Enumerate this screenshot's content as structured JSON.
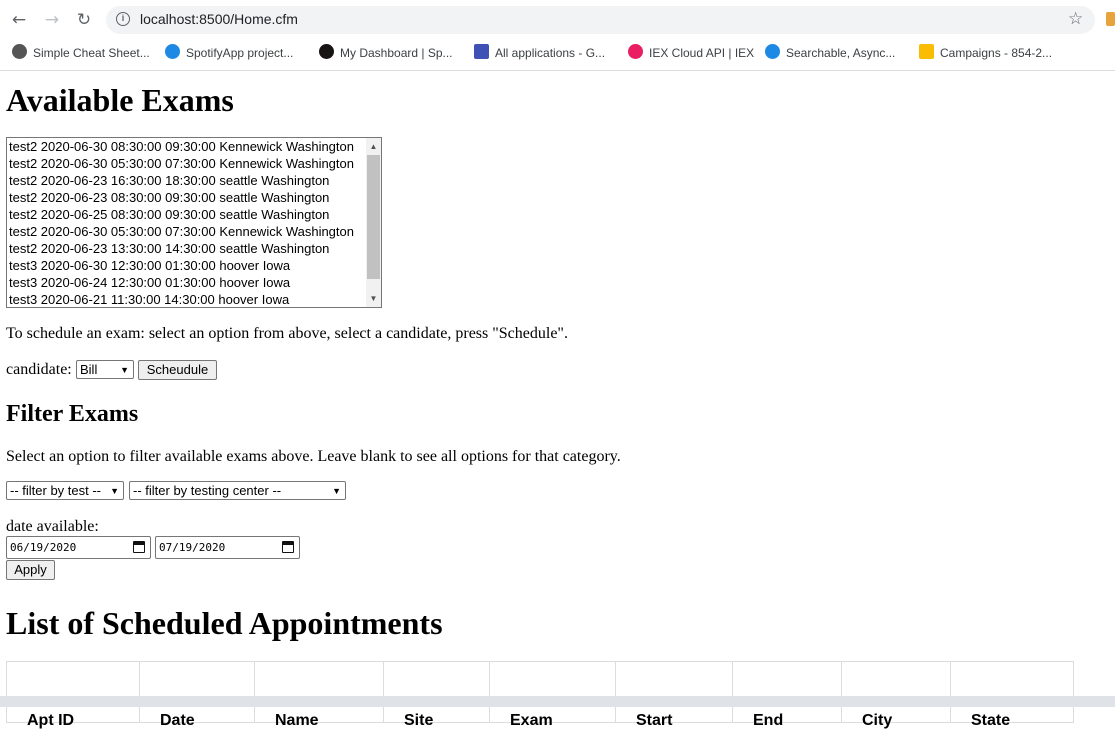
{
  "browser": {
    "url": "localhost:8500/Home.cfm",
    "bookmarks": [
      {
        "label": "Simple Cheat Sheet...",
        "color": "#555555"
      },
      {
        "label": "SpotifyApp project...",
        "color": "#1e88e5"
      },
      {
        "label": "My Dashboard | Sp...",
        "color": "#191414"
      },
      {
        "label": "All applications - G...",
        "color": "#3f51b5"
      },
      {
        "label": "IEX Cloud API | IEX",
        "color": "#e91e63"
      },
      {
        "label": "Searchable, Async...",
        "color": "#1e88e5"
      },
      {
        "label": "Campaigns - 854-2...",
        "color": "#fbbc04"
      }
    ]
  },
  "page": {
    "available_title": "Available Exams",
    "exams": [
      "test2 2020-06-30 08:30:00 09:30:00 Kennewick Washington",
      "test2 2020-06-30 05:30:00 07:30:00 Kennewick Washington",
      "test2 2020-06-23 16:30:00 18:30:00 seattle Washington",
      "test2 2020-06-23 08:30:00 09:30:00 seattle Washington",
      "test2 2020-06-25 08:30:00 09:30:00 seattle Washington",
      "test2 2020-06-30 05:30:00 07:30:00 Kennewick Washington",
      "test2 2020-06-23 13:30:00 14:30:00 seattle Washington",
      "test3 2020-06-30 12:30:00 01:30:00 hoover Iowa",
      "test3 2020-06-24 12:30:00 01:30:00 hoover Iowa",
      "test3 2020-06-21 11:30:00 14:30:00 hoover Iowa"
    ],
    "schedule_instructions": "To schedule an exam: select an option from above, select a candidate, press \"Schedule\".",
    "candidate_label": "candidate:",
    "candidate_value": "Bill",
    "schedule_button": "Scheudule",
    "filter_title": "Filter Exams",
    "filter_instructions": "Select an option to filter available exams above. Leave blank to see all options for that category.",
    "filter_test": "-- filter by test --",
    "filter_center": "-- filter by testing center --",
    "date_label": "date available:",
    "date_from": "06/19/2020",
    "date_to": "07/19/2020",
    "apply_button": "Apply",
    "appointments_title": "List of Scheduled Appointments",
    "appointment_columns": [
      "Apt ID",
      "Date",
      "Name",
      "Site",
      "Exam",
      "Start",
      "End",
      "City",
      "State"
    ]
  }
}
